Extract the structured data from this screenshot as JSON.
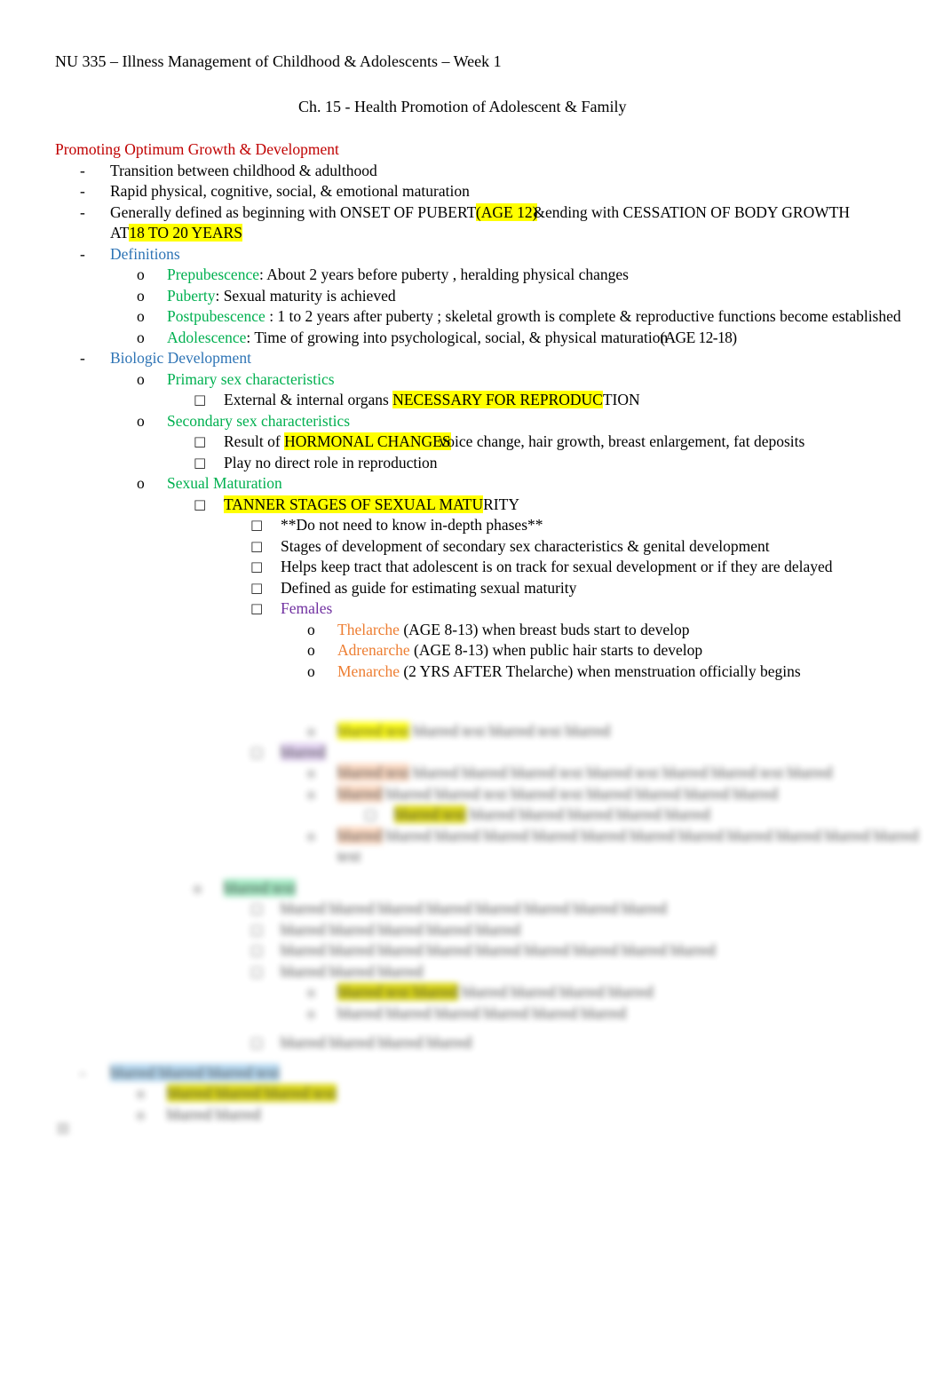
{
  "document": {
    "header": "NU 335 – Illness Management of Childhood & Adolescents – Week 1",
    "subtitle": "Ch. 15 - Health Promotion of Adolescent & Family"
  },
  "colors": {
    "heading_red": "#C00000",
    "heading_blue": "#2E74B5",
    "term_green": "#00B050",
    "term_orange": "#ED7D31",
    "term_purple": "#7030A0",
    "highlight_yellow": "#FFFF00",
    "highlight_green": "#9BE8BE",
    "highlight_blue": "#AFD5F0",
    "highlight_peach": "#FBD5BC",
    "text_black": "#000000"
  },
  "markers": {
    "dash": "-",
    "circle": "o",
    "box": "□"
  },
  "sections": {
    "promoting": {
      "heading": "Promoting Optimum Growth & Development",
      "bullet1": "Transition between childhood & adulthood",
      "bullet2": "Rapid physical, cognitive, social, & emotional maturation",
      "bullet3_a": "Generally defined as beginning with ONSET OF PUBERTY",
      "bullet3_b": "(AGE 12)",
      "bullet3_c": "&",
      "bullet3_d": "ending with CESSATION OF BODY GROWTH",
      "bullet3_e": "AT",
      "bullet3_f": "18 TO 20 YEARS"
    },
    "definitions": {
      "heading": "Definitions",
      "items": [
        {
          "term": "Prepubescence",
          "sep": ": About 2 years before puberty  , heralding physical changes"
        },
        {
          "term": "Puberty",
          "sep": ": Sexual maturity  is achieved"
        },
        {
          "term": "Postpubescence",
          "sep": " : 1 to 2 years after puberty  ; skeletal growth  is complete & reproductive functions become established"
        },
        {
          "term": "Adolescence",
          "sep": ": Time of growing into psychological, social, & physical maturation",
          "paren": "(AGE 12-18)"
        }
      ]
    },
    "biologic": {
      "heading": "Biologic Development",
      "primary": {
        "heading": "Primary sex characteristics",
        "detail_a": "External & internal organs ",
        "detail_hl": "NECESSARY FOR REPRODUC",
        "detail_b": "TION"
      },
      "secondary": {
        "heading": "Secondary sex characteristics",
        "detail1_a": "Result of ",
        "detail1_hl": "HORMONAL CHANGES",
        "detail1_b": "voice change, hair growth, breast enlargement, fat deposits",
        "detail2": "Play no direct role in reproduction"
      },
      "sexual_maturation": {
        "heading": "Sexual Maturation",
        "tanner_hl": "TANNER STAGES OF SEXUAL MATU",
        "tanner_tail": "RITY",
        "sub": [
          "**Do not need to know in-depth phases**",
          "Stages of development of secondary sex characteristics & genital development",
          "Helps keep tract that adolescent is on track for sexual development or if they are delayed",
          "Defined as guide for estimating sexual maturity"
        ],
        "females": {
          "heading": "Females",
          "items": [
            {
              "term": "Thelarche",
              "rest": " (AGE 8-13) when breast buds start to develop"
            },
            {
              "term": "Adrenarche",
              "rest": " (AGE 8-13) when public hair starts to develop"
            },
            {
              "term": "Menarche",
              "rest": " (2 YRS AFTER Thelarche) when menstruation officially begins"
            }
          ]
        }
      }
    },
    "obscured": {
      "note": "lower portion of page is blurred and illegible",
      "lines": [
        {
          "indent": 5,
          "marker": "o",
          "hl": "blurred text",
          "rest": "blurred text blurred text blurred"
        },
        {
          "indent": 4,
          "marker": "box",
          "hl": "blurred",
          "rest": ""
        },
        {
          "indent": 5,
          "marker": "o",
          "hl": "blurred text",
          "rest": "blurred blurred blurred text blurred text blurred blurred text blurred"
        },
        {
          "indent": 5,
          "marker": "o",
          "hl": "blurred",
          "rest": "blurred blurred text blurred text blurred blurred blurred blurred"
        },
        {
          "indent": 6,
          "marker": "box",
          "hl": "blurred text",
          "rest": "blurred blurred blurred blurred blurred"
        },
        {
          "indent": 5,
          "marker": "o",
          "hl": "blurred",
          "rest": "blurred blurred blurred blurred blurred blurred blurred blurred blurred blurred blurred text"
        },
        {
          "indent": 3,
          "marker": "o",
          "hl": "blurred text",
          "rest": ""
        },
        {
          "indent": 4,
          "marker": "box",
          "hl": "",
          "rest": "blurred blurred blurred blurred blurred blurred blurred blurred"
        },
        {
          "indent": 4,
          "marker": "box",
          "hl": "",
          "rest": "blurred blurred blurred blurred blurred"
        },
        {
          "indent": 4,
          "marker": "box",
          "hl": "",
          "rest": "blurred blurred blurred blurred blurred blurred blurred blurred blurred"
        },
        {
          "indent": 4,
          "marker": "box",
          "hl": "",
          "rest": "blurred blurred blurred"
        },
        {
          "indent": 5,
          "marker": "o",
          "hl": "blurred text blurred",
          "rest": "blurred blurred blurred blurred"
        },
        {
          "indent": 5,
          "marker": "o",
          "hl": "",
          "rest": "blurred blurred blurred blurred blurred blurred"
        },
        {
          "indent": 4,
          "marker": "box",
          "hl": "",
          "rest": "blurred blurred blurred blurred"
        },
        {
          "indent": 1,
          "marker": "dash",
          "hl": "blurred blurred blurred text",
          "rest": ""
        },
        {
          "indent": 2,
          "marker": "o",
          "hl": "blurred blurred blurred text",
          "rest": ""
        },
        {
          "indent": 2,
          "marker": "o",
          "hl": "",
          "rest": "blurred blurred"
        }
      ]
    }
  }
}
